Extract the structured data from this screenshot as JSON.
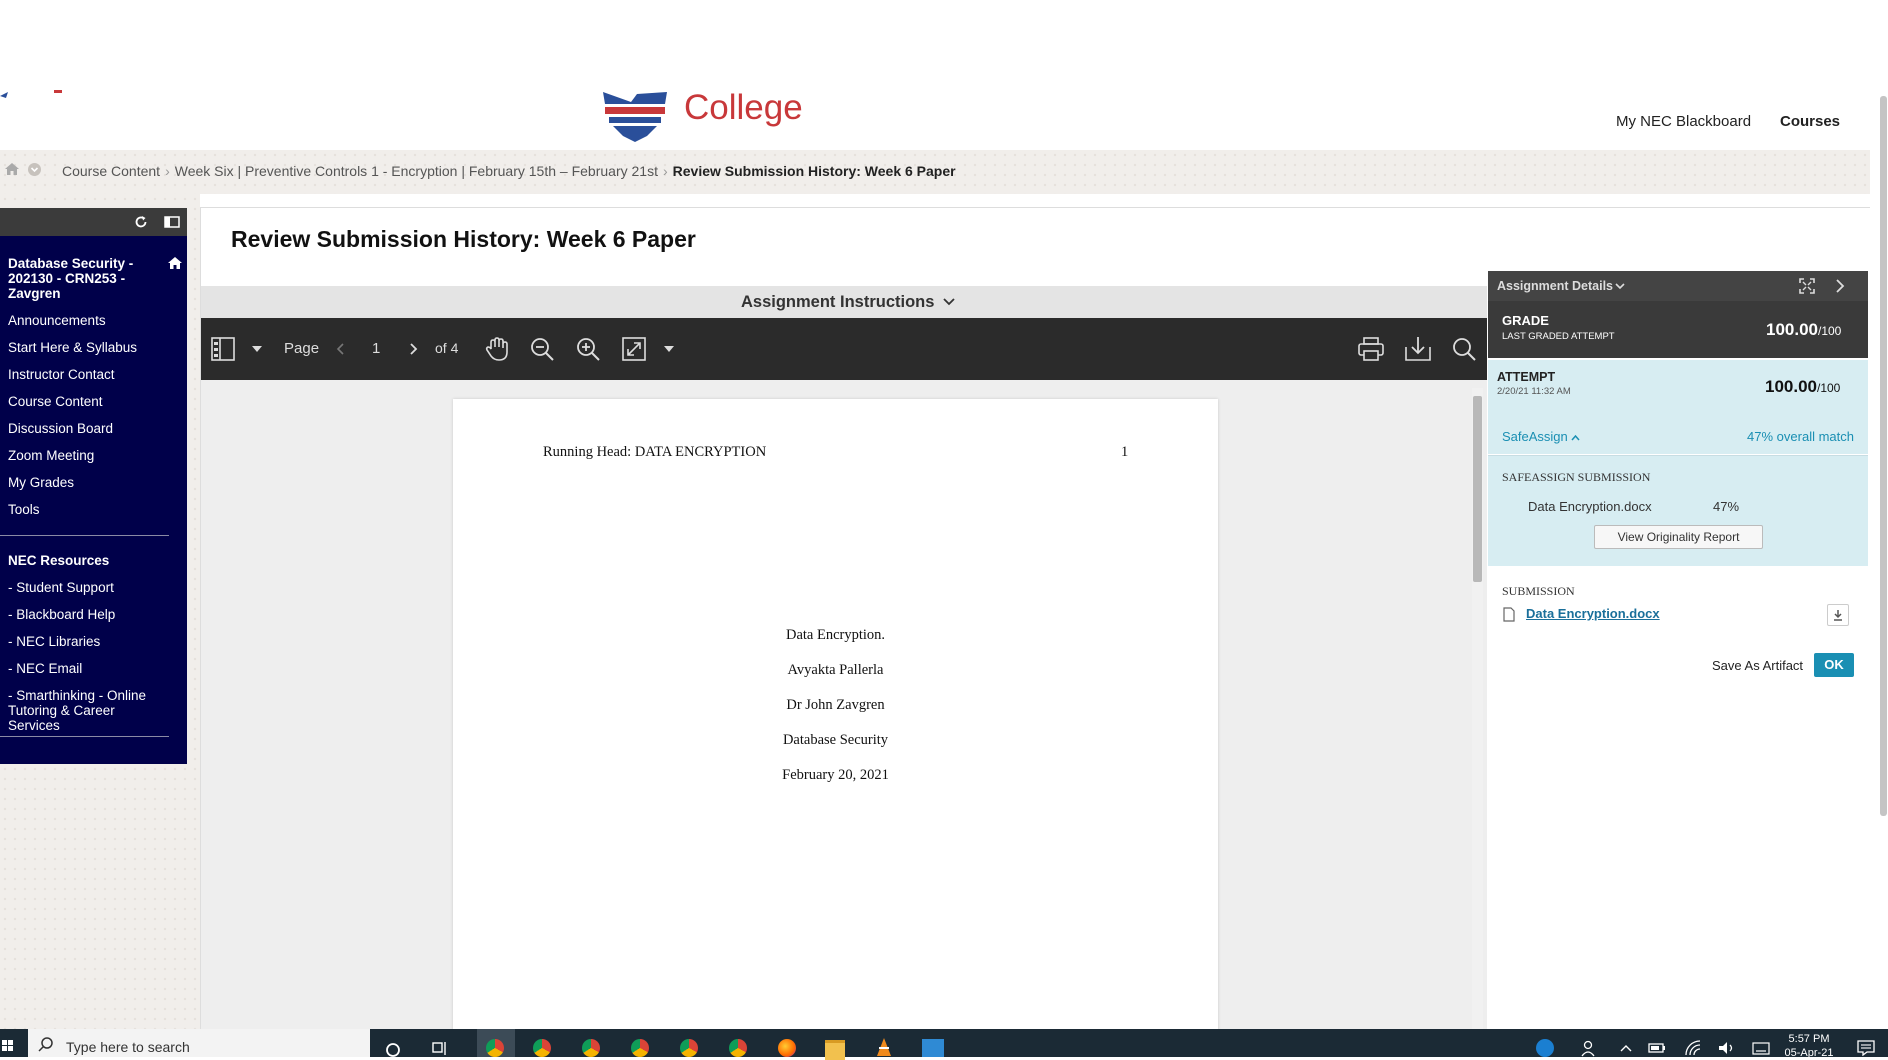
{
  "header": {
    "logo_text": "College",
    "nav": [
      "My NEC Blackboard",
      "Courses"
    ]
  },
  "breadcrumb": {
    "items": [
      "Course Content",
      "Week Six | Preventive Controls 1 - Encryption | February 15th – February 21st"
    ],
    "current": "Review Submission History: Week 6 Paper"
  },
  "sidebar": {
    "course_title": "Database Security - 202130 - CRN253 - Zavgren",
    "items": [
      "Announcements",
      "Start Here & Syllabus",
      "Instructor Contact",
      "Course Content",
      "Discussion Board",
      "Zoom Meeting",
      "My Grades",
      "Tools"
    ],
    "resources_heading": "NEC Resources",
    "resources": [
      "- Student Support",
      "- Blackboard Help",
      "- NEC Libraries",
      "- NEC Email",
      "- Smarthinking - Online Tutoring & Career Services"
    ]
  },
  "main": {
    "title": "Review Submission History: Week 6 Paper",
    "instructions_label": "Assignment Instructions"
  },
  "viewer": {
    "page_label": "Page",
    "page_number": "1",
    "page_total": "of 4"
  },
  "document": {
    "running_head": "Running Head: DATA ENCRYPTION",
    "page_num": "1",
    "lines": [
      "Data Encryption.",
      "Avyakta Pallerla",
      "Dr John Zavgren",
      "Database Security",
      "February 20, 2021"
    ]
  },
  "details": {
    "header": "Assignment Details",
    "grade_label": "GRADE",
    "grade_sub": "LAST GRADED ATTEMPT",
    "grade_value": "100.00",
    "grade_max": "/100",
    "attempt_label": "ATTEMPT",
    "attempt_date": "2/20/21 11:32 AM",
    "attempt_value": "100.00",
    "attempt_max": "/100",
    "safeassign_label": "SafeAssign",
    "overall_match": "47% overall match",
    "sa_submission_label": "SAFEASSIGN SUBMISSION",
    "sa_file": "Data Encryption.docx",
    "sa_percent": "47%",
    "report_button": "View Originality Report",
    "submission_label": "SUBMISSION",
    "submission_file": "Data Encryption.docx",
    "save_artifact": "Save As Artifact",
    "ok_button": "OK"
  },
  "taskbar": {
    "search_placeholder": "Type here to search",
    "time": "5:57 PM",
    "date": "05-Apr-21"
  },
  "colors": {
    "sidebar_bg": "#00004a",
    "brand_red": "#c8383a",
    "accent_teal": "#1a8fb3",
    "panel_blue": "#d7edf2"
  }
}
